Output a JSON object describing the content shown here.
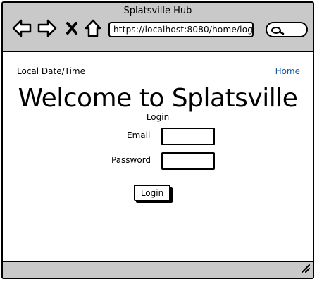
{
  "window": {
    "title": "Splatsville Hub",
    "url": "https://localhost:8080/home/logi"
  },
  "toolbar": {
    "icons": [
      "back-arrow-icon",
      "forward-arrow-icon",
      "close-icon",
      "home-icon",
      "search-icon"
    ]
  },
  "header": {
    "datetime_label": "Local Date/Time",
    "home_link": "Home"
  },
  "main": {
    "heading": "Welcome to Splatsville",
    "subtitle": "Login",
    "form": {
      "email_label": "Email",
      "email_value": "",
      "password_label": "Password",
      "password_value": "",
      "submit_label": "Login"
    }
  },
  "colors": {
    "chrome": "#c9c9c9",
    "link": "#1a5aa3",
    "border": "#000000"
  }
}
